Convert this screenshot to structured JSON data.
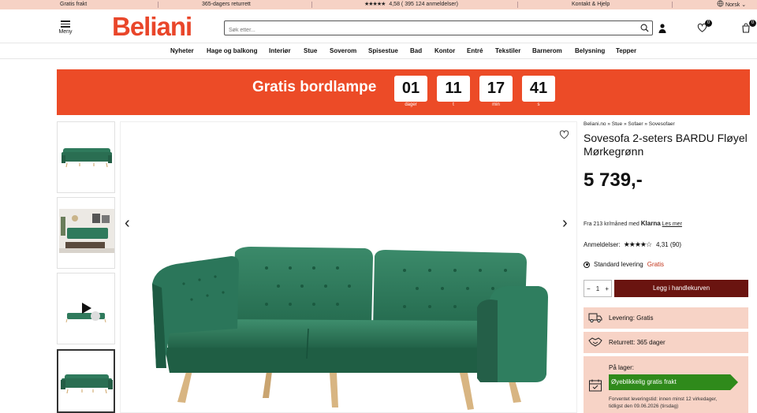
{
  "topbar": {
    "free_shipping": "Gratis frakt",
    "returns": "365-dagers returrett",
    "rating_text": "4,58 ( 395 124 anmeldelser)",
    "contact": "Kontakt & Hjelp",
    "language": "Norsk"
  },
  "header": {
    "menu_label": "Meny",
    "logo_text": "Beliani",
    "search_placeholder": "Søk etter...",
    "wishlist_count": "0",
    "cart_count": "0"
  },
  "nav": {
    "items": [
      "Nyheter",
      "Hage og balkong",
      "Interiør",
      "Stue",
      "Soverom",
      "Spisestue",
      "Bad",
      "Kontor",
      "Entré",
      "Tekstiler",
      "Barnerom",
      "Belysning",
      "Tepper"
    ]
  },
  "promo": {
    "title": "Gratis bordlampe",
    "countdown": [
      {
        "value": "01",
        "unit": "dager"
      },
      {
        "value": "11",
        "unit": "t"
      },
      {
        "value": "17",
        "unit": "min"
      },
      {
        "value": "41",
        "unit": "s"
      }
    ]
  },
  "product": {
    "breadcrumb": "Beliani.no » Stue » Sofaer » Sovesofaer",
    "title": "Sovesofa 2-seters BARDU Fløyel Mørkegrønn",
    "price": "5 739,-",
    "klarna_prefix": "Fra 213 kr/måned med",
    "klarna_brand": "Klarna",
    "klarna_link": "Les mer",
    "reviews_label": "Anmeldelser:",
    "reviews_value": "4,31 (90)",
    "shipping_label": "Standard levering",
    "shipping_price": "Gratis",
    "quantity": "1",
    "add_to_cart": "Legg i handlekurven",
    "delivery_label": "Levering:",
    "delivery_value": "Gratis",
    "returns_label": "Returrett:",
    "returns_value": "365 dager",
    "stock_label": "På lager:",
    "stock_badge": "Øyeblikkelig gratis frakt",
    "eta_line1": "Forventet leveringstid: innen minst 12 virkedager,",
    "eta_line2": "tidligst den 09.06.2026 (tirsdag)"
  },
  "colors": {
    "brand": "#e9462a",
    "promo_bg": "#ec4b27",
    "topbar_bg": "#f6d2c5",
    "cart_button": "#6a1410",
    "stock_green": "#2f8a1b",
    "sofa_green": "#2f7a5c"
  }
}
